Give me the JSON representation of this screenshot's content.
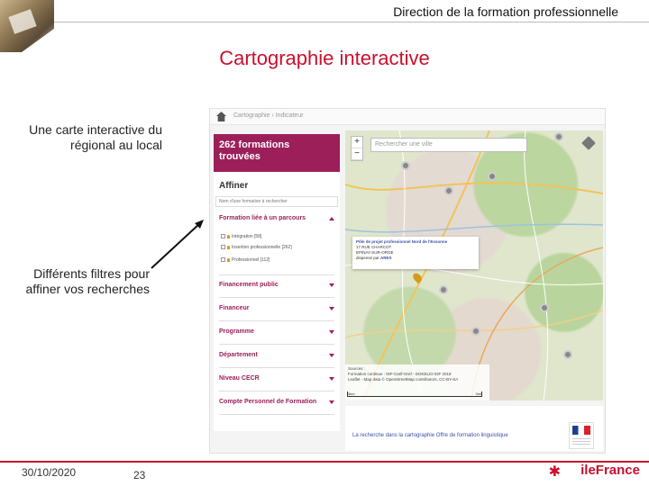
{
  "header": {
    "title": "Direction de la formation professionnelle"
  },
  "slide": {
    "title": "Cartographie interactive"
  },
  "notes": {
    "note1": "Une carte interactive du régional au local",
    "note2": "Différents filtres pour affiner vos recherches"
  },
  "screenshot": {
    "breadcrumb": "Cartographie  ›  Indicateur",
    "count_box": {
      "line1": "262 formations",
      "line2": "trouvées"
    },
    "affiner": {
      "title": "Affiner",
      "input_placeholder": "Nom d'une formation à rechercher"
    },
    "filters": [
      {
        "label": "Formation liée à un parcours",
        "open": true
      },
      {
        "label": "Financement public",
        "open": false
      },
      {
        "label": "Financeur",
        "open": false
      },
      {
        "label": "Programme",
        "open": false
      },
      {
        "label": "Département",
        "open": false
      },
      {
        "label": "Niveau CECR",
        "open": false
      },
      {
        "label": "Compte Personnel de Formation",
        "open": false
      }
    ],
    "options": [
      {
        "label": "Intégration [58]"
      },
      {
        "label": "Insertion professionnelle [262]"
      },
      {
        "label": "Professionnel [112]"
      }
    ],
    "map": {
      "search_placeholder": "Rechercher une ville",
      "zoom_in": "+",
      "zoom_out": "−",
      "popup": {
        "title": "Pôle de projet professionnel Nord de l'Essonne",
        "line1": "17 RUE CHARCOT",
        "line2": "EPINAY-SUR-ORGE",
        "line3": "dispensé par",
        "link": "ARES"
      },
      "source": {
        "line1": "Sources :",
        "line2": "Formation continue : IDF-Carif-Oref - DOKELIO IDF 2018",
        "line3": "Leaflet - Map data © OpenStreetMap contributors, CC-BY-SA"
      },
      "scale": {
        "left": "5km",
        "right": "3mi"
      }
    },
    "footer_link": "La recherche dans la cartographie Offre de formation linguistique"
  },
  "footer": {
    "date": "30/10/2020",
    "page_number": "23",
    "logo": "ileFrance"
  },
  "colors": {
    "accent": "#c8102e",
    "sidebar_brand": "#9c1f5a",
    "link": "#3a4fa6"
  },
  "icons": {
    "home": "home-icon",
    "layers": "layers-icon",
    "map_pin": "map-pin-icon",
    "star": "star-icon"
  }
}
